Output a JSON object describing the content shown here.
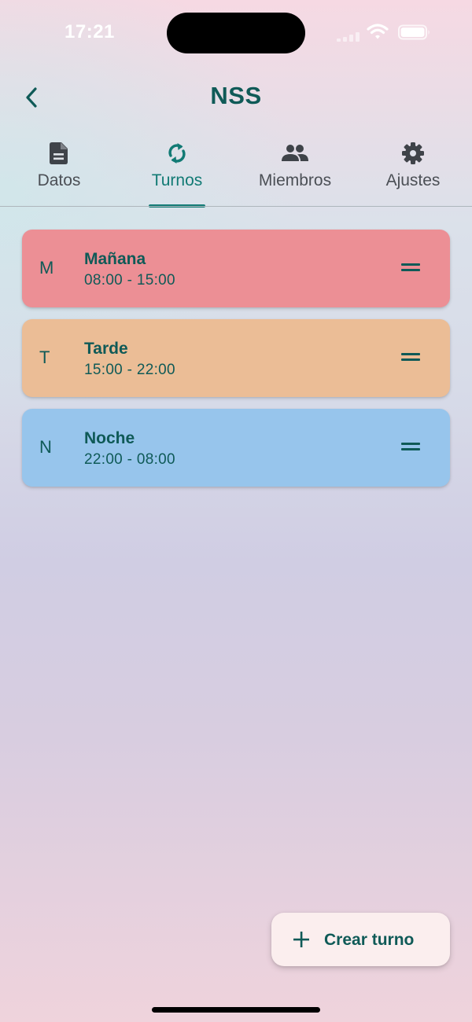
{
  "status_bar": {
    "time": "17:21",
    "icons": [
      "signal-icon",
      "wifi-icon",
      "battery-icon"
    ]
  },
  "header": {
    "title": "NSS",
    "back_icon": "chevron-left-icon"
  },
  "tabs": [
    {
      "label": "Datos",
      "icon": "document-icon",
      "active": false
    },
    {
      "label": "Turnos",
      "icon": "sync-icon",
      "active": true
    },
    {
      "label": "Miembros",
      "icon": "people-icon",
      "active": false
    },
    {
      "label": "Ajustes",
      "icon": "gear-icon",
      "active": false
    }
  ],
  "shifts": [
    {
      "letter": "M",
      "name": "Mañana",
      "time": "08:00 - 15:00",
      "color": "#ec8f95"
    },
    {
      "letter": "T",
      "name": "Tarde",
      "time": "15:00 - 22:00",
      "color": "#ebbd96"
    },
    {
      "letter": "N",
      "name": "Noche",
      "time": "22:00 - 08:00",
      "color": "#97c5ec"
    }
  ],
  "fab": {
    "label": "Crear turno",
    "icon": "plus-icon"
  },
  "colors": {
    "accent": "#117a74",
    "text_dark": "#0f5a57",
    "inactive_tab": "#4b4f55"
  }
}
